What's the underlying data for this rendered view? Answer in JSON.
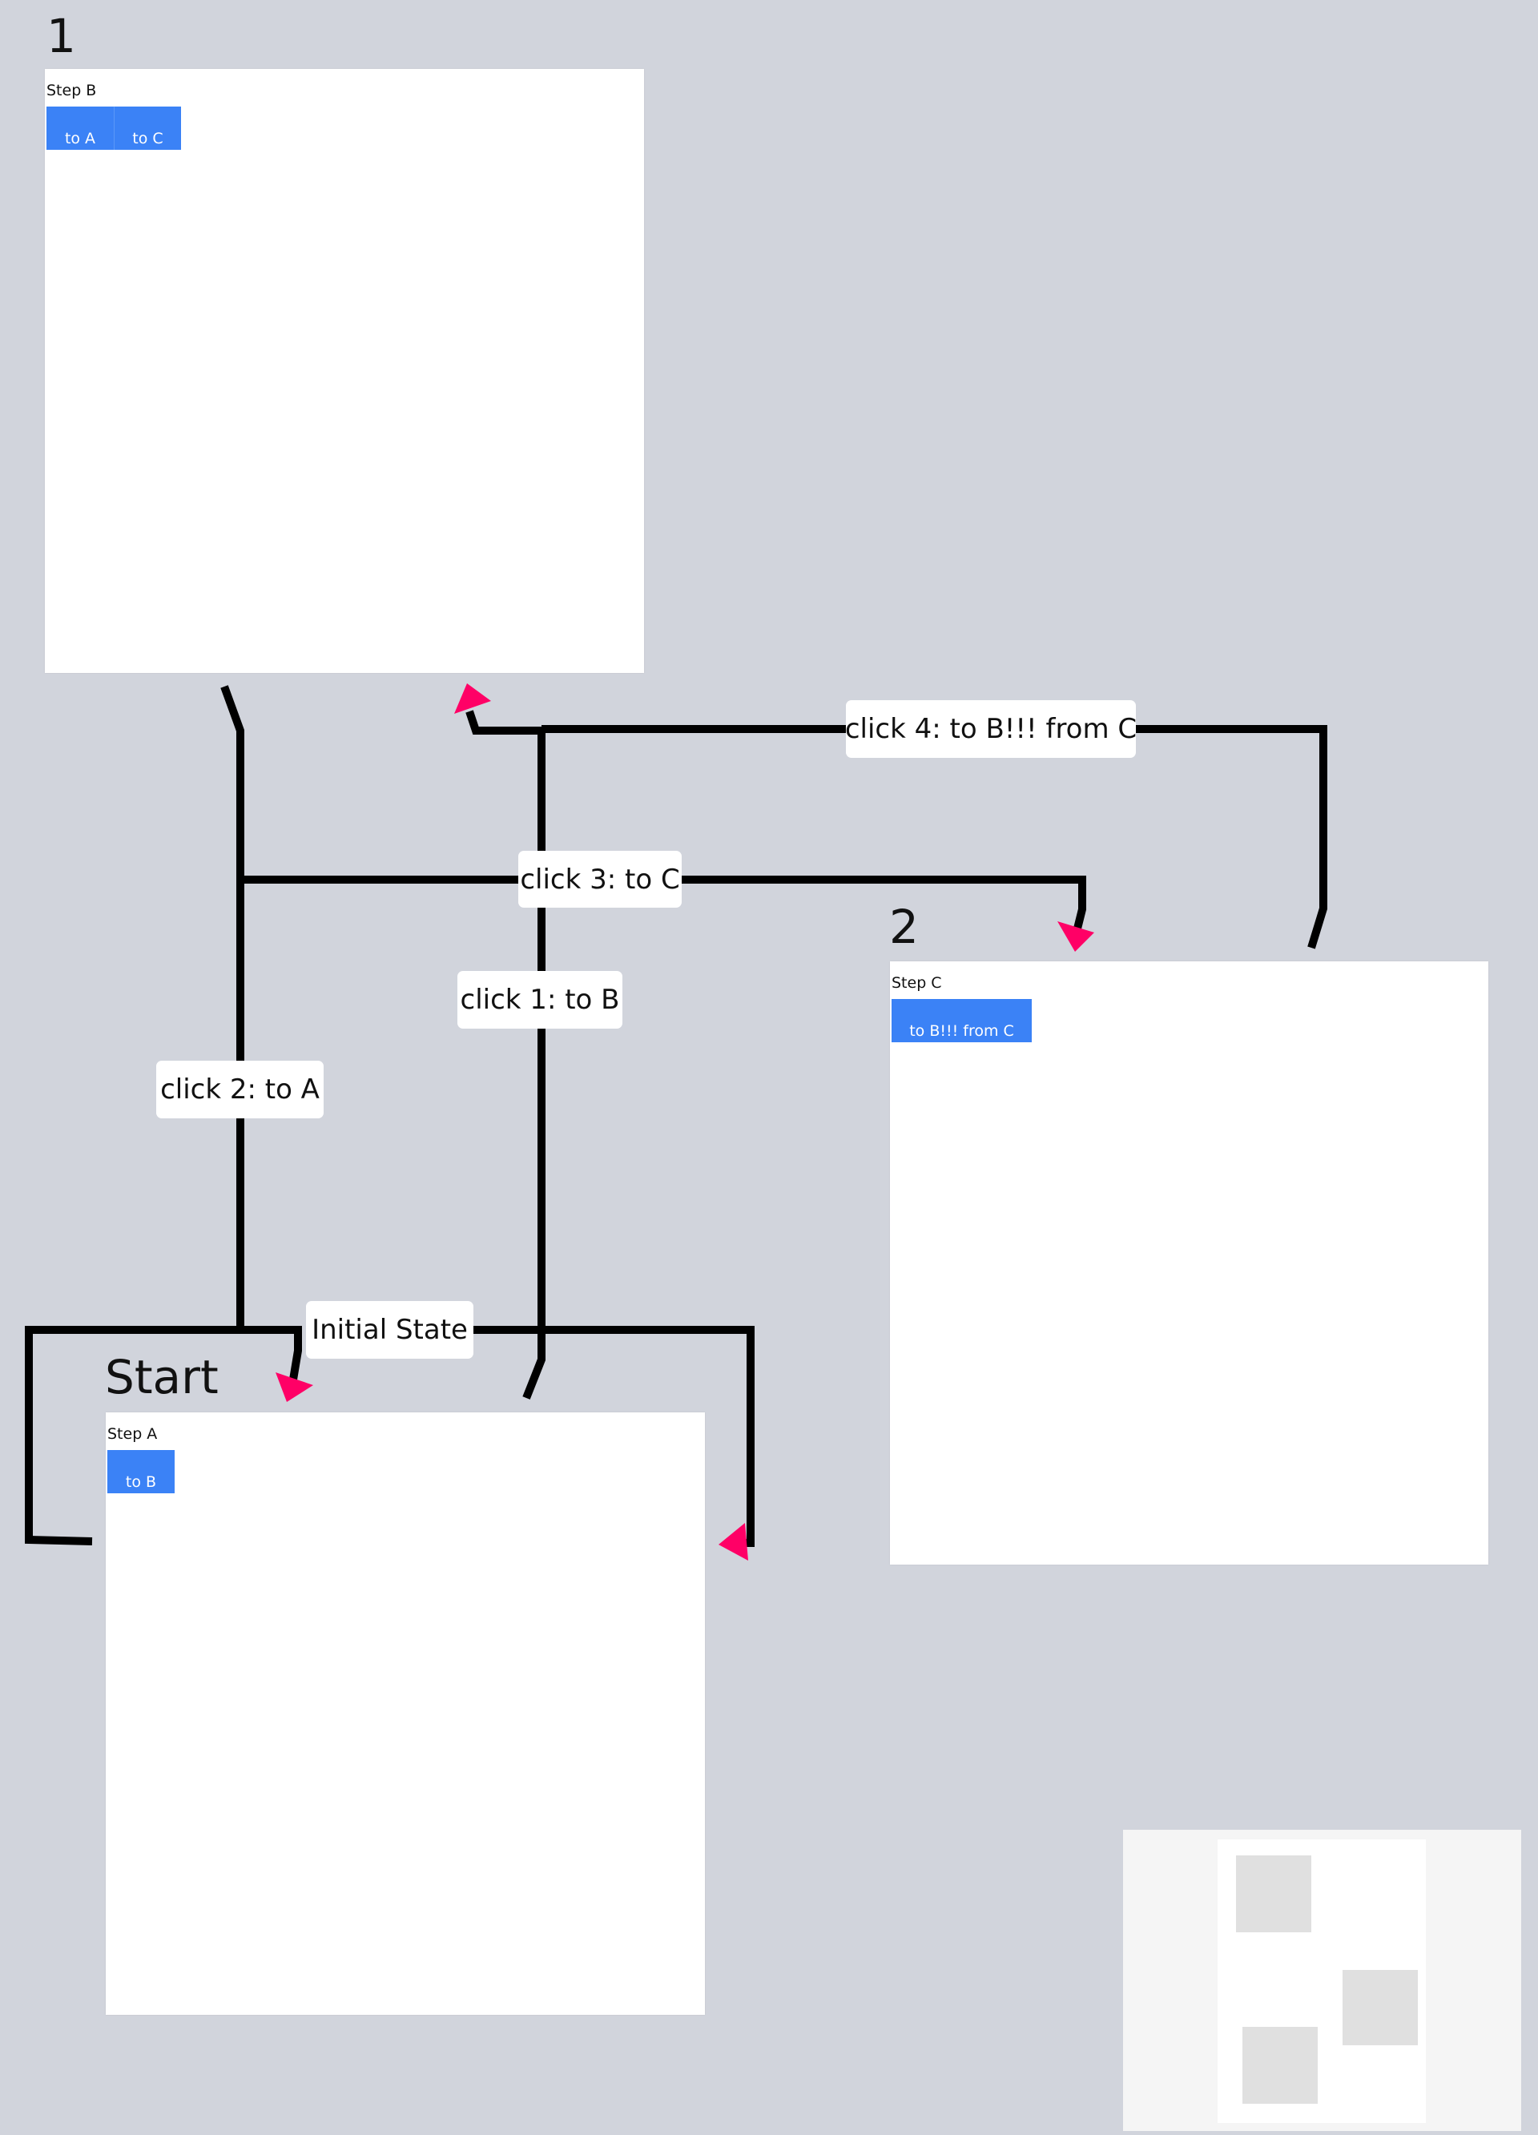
{
  "nodes": [
    {
      "id": "B",
      "title": "1",
      "step_label": "Step B",
      "buttons": [
        {
          "label": "to A"
        },
        {
          "label": "to C"
        }
      ]
    },
    {
      "id": "C",
      "title": "2",
      "step_label": "Step C",
      "buttons": [
        {
          "label": "to B!!! from C"
        }
      ]
    },
    {
      "id": "A",
      "title": "Start",
      "step_label": "Step A",
      "buttons": [
        {
          "label": "to B"
        }
      ]
    }
  ],
  "edges": [
    {
      "label": "Initial State",
      "from": "A",
      "to": "A"
    },
    {
      "label": "click 1: to B",
      "from": "A",
      "to": "B"
    },
    {
      "label": "click 2: to A",
      "from": "B",
      "to": "A"
    },
    {
      "label": "click 3: to C",
      "from": "B",
      "to": "C"
    },
    {
      "label": "click 4: to B!!! from C",
      "from": "C",
      "to": "B"
    }
  ],
  "colors": {
    "background": "#d1d4dc",
    "panel": "#ffffff",
    "button": "#3b82f6",
    "edge_line": "#000000",
    "arrowhead": "#ff0066",
    "minimap_bg": "#f5f5f5",
    "minimap_node": "#e0e0e0"
  },
  "minimap": {
    "node_count": 3
  }
}
